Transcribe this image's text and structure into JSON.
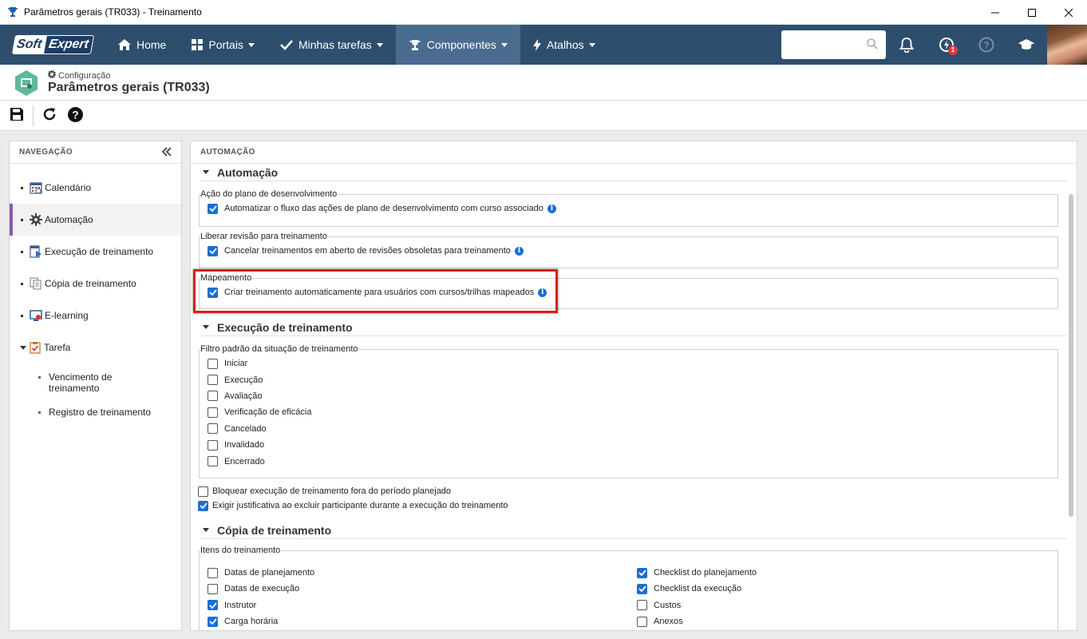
{
  "window": {
    "title": "Parâmetros gerais (TR033) - Treinamento",
    "controls": [
      "minimize-icon",
      "maximize-icon",
      "close-icon"
    ]
  },
  "brand": {
    "logo_left": "Soft",
    "logo_right": "Expert"
  },
  "nav": {
    "items": [
      {
        "label": "Home",
        "icon": "home-icon",
        "caret": false
      },
      {
        "label": "Portais",
        "icon": "grid-icon",
        "caret": true
      },
      {
        "label": "Minhas tarefas",
        "icon": "check-icon",
        "caret": true
      },
      {
        "label": "Componentes",
        "icon": "trophy-icon",
        "caret": true,
        "active": true
      },
      {
        "label": "Atalhos",
        "icon": "bolt-icon",
        "caret": true
      }
    ],
    "search_placeholder": "",
    "notification_badge": "1"
  },
  "header": {
    "breadcrumb": "Configuração",
    "title": "Parâmetros gerais (TR033)"
  },
  "left_panel": {
    "heading": "NAVEGAÇÃO",
    "items": [
      {
        "label": "Calendário"
      },
      {
        "label": "Automação"
      },
      {
        "label": "Execução de treinamento"
      },
      {
        "label": "Cópia de treinamento"
      },
      {
        "label": "E-learning"
      },
      {
        "label": "Tarefa"
      }
    ],
    "subitems": [
      {
        "label": "Vencimento de treinamento"
      },
      {
        "label": "Registro de treinamento"
      }
    ]
  },
  "main": {
    "heading": "AUTOMAÇÃO",
    "sections": {
      "automacao": {
        "title": "Automação",
        "groups": [
          {
            "legend": "Ação do plano de desenvolvimento",
            "option": "Automatizar o fluxo das ações de plano de desenvolvimento com curso associado",
            "checked": true
          },
          {
            "legend": "Liberar revisão para treinamento",
            "option": "Cancelar treinamentos em aberto de revisões obsoletas para treinamento",
            "checked": true
          },
          {
            "legend": "Mapeamento",
            "option": "Criar treinamento automaticamente para usuários com cursos/trilhas mapeados",
            "checked": true
          }
        ]
      },
      "execucao": {
        "title": "Execução de treinamento",
        "filter_legend": "Filtro padrão da situação de treinamento",
        "filters": [
          {
            "label": "Iniciar",
            "checked": false
          },
          {
            "label": "Execução",
            "checked": false
          },
          {
            "label": "Avaliação",
            "checked": false
          },
          {
            "label": "Verificação de eficácia",
            "checked": false
          },
          {
            "label": "Cancelado",
            "checked": false
          },
          {
            "label": "Invalidado",
            "checked": false
          },
          {
            "label": "Encerrado",
            "checked": false
          }
        ],
        "options": [
          {
            "label": "Bloquear execução de treinamento fora do período planejado",
            "checked": false
          },
          {
            "label": "Exigir justificativa ao excluir participante durante a execução do treinamento",
            "checked": true
          }
        ]
      },
      "copia": {
        "title": "Cópia de treinamento",
        "items_legend": "Itens do treinamento",
        "left_items": [
          {
            "label": "Datas de planejamento",
            "checked": false
          },
          {
            "label": "Datas de execução",
            "checked": false
          },
          {
            "label": "Instrutor",
            "checked": true
          },
          {
            "label": "Carga horária",
            "checked": true
          }
        ],
        "right_items": [
          {
            "label": "Checklist do planejamento",
            "checked": true
          },
          {
            "label": "Checklist da execução",
            "checked": true
          },
          {
            "label": "Custos",
            "checked": false
          },
          {
            "label": "Anexos",
            "checked": false
          }
        ]
      }
    }
  },
  "colors": {
    "nav_bg": "#2e4e6e",
    "nav_active": "#4a6c8f",
    "checkbox_on": "#1a6fd4",
    "highlight": "#d42020",
    "selected_bar": "#8e5aa8"
  }
}
